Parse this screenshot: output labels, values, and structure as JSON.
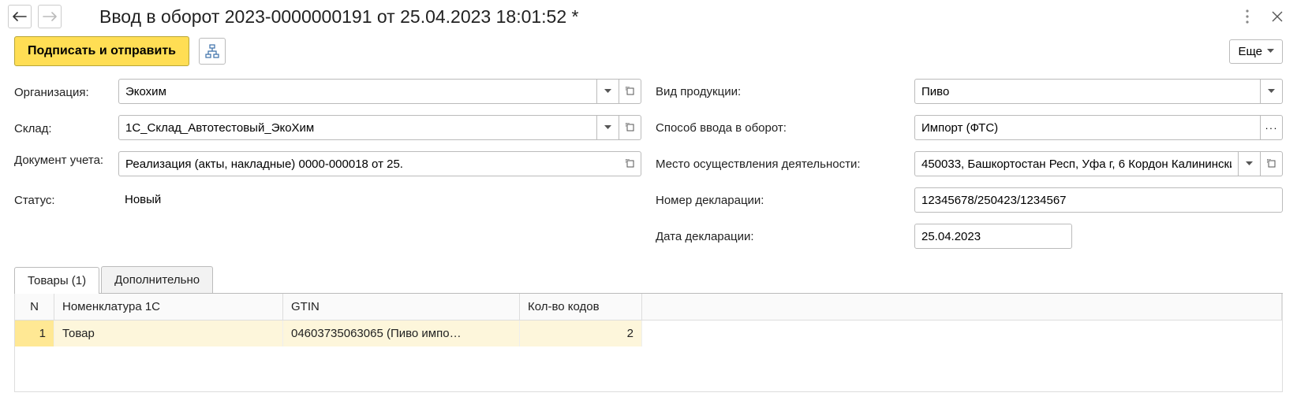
{
  "header": {
    "title": "Ввод в оборот 2023-0000000191 от 25.04.2023 18:01:52 *"
  },
  "actions": {
    "sign_send": "Подписать и отправить",
    "more": "Еще"
  },
  "form": {
    "left": {
      "org_label": "Организация:",
      "org_value": "Экохим",
      "warehouse_label": "Склад:",
      "warehouse_value": "1С_Склад_Автотестовый_ЭкоХим",
      "doc_label": "Документ учета:",
      "doc_value": "Реализация (акты, накладные) 0000-000018 от 25.",
      "status_label": "Статус:",
      "status_value": "Новый"
    },
    "right": {
      "product_type_label": "Вид продукции:",
      "product_type_value": "Пиво",
      "entry_method_label": "Способ ввода в оборот:",
      "entry_method_value": "Импорт (ФТС)",
      "activity_place_label": "Место осуществления деятельности:",
      "activity_place_value": "450033, Башкортостан Респ, Уфа г, 6 Кордон Калинински",
      "decl_num_label": "Номер декларации:",
      "decl_num_value": "12345678/250423/1234567",
      "decl_date_label": "Дата декларации:",
      "decl_date_value": "25.04.2023"
    }
  },
  "tabs": {
    "goods": "Товары (1)",
    "additional": "Дополнительно"
  },
  "grid": {
    "headers": {
      "n": "N",
      "nomenclature": "Номенклатура 1С",
      "gtin": "GTIN",
      "qty": "Кол-во кодов"
    },
    "rows": [
      {
        "n": "1",
        "nomenclature": "Товар",
        "gtin": "04603735063065 (Пиво импо…",
        "qty": "2"
      }
    ]
  }
}
